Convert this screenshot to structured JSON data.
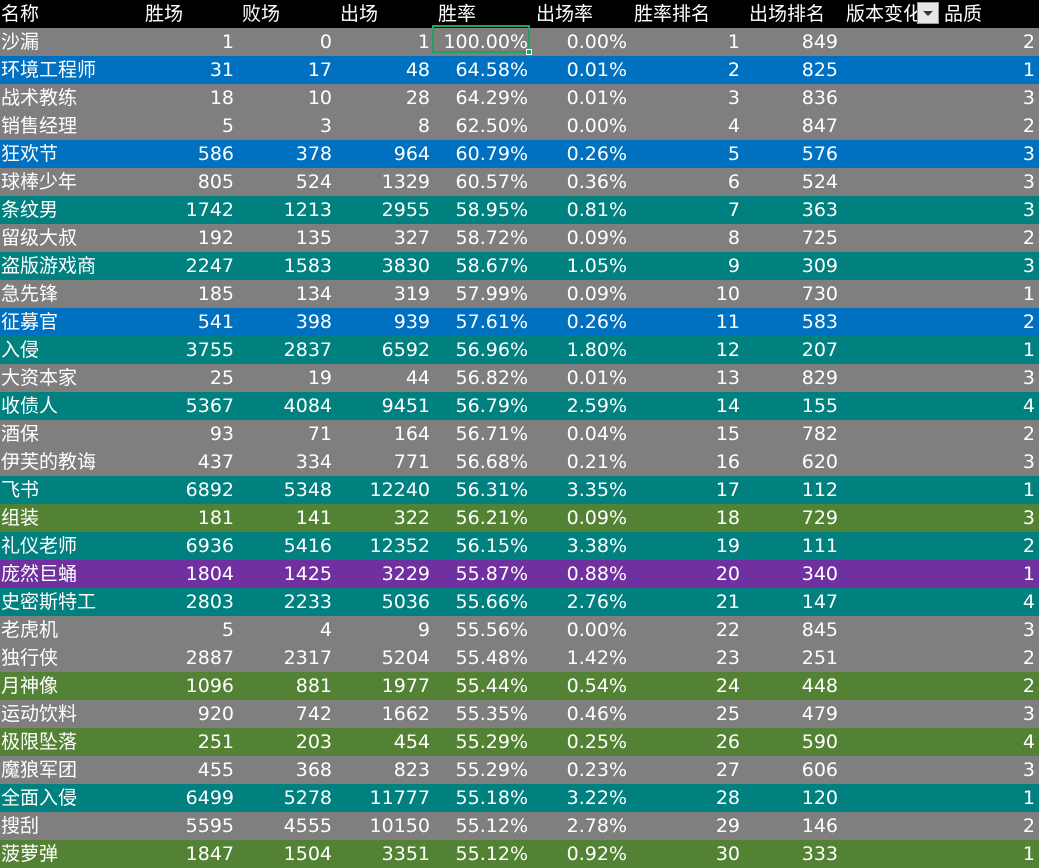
{
  "headers": [
    "名称",
    "胜场",
    "败场",
    "出场",
    "胜率",
    "出场率",
    "胜率排名",
    "出场排名",
    "版本变化",
    "品质"
  ],
  "colors": {
    "gray": "#7f7f7f",
    "blue": "#0070c0",
    "teal": "#00807f",
    "olive": "#548235",
    "purple": "#7030a0",
    "header": "#000000",
    "selection": "#21a366"
  },
  "filter_icon": "dropdown-arrow-icon",
  "rows": [
    {
      "name": "沙漏",
      "wins": "1",
      "losses": "0",
      "games": "1",
      "win_rate": "100.00%",
      "play_rate": "0.00%",
      "win_rank": "1",
      "play_rank": "849",
      "version_change": "",
      "quality": "2",
      "color": "gray"
    },
    {
      "name": "环境工程师",
      "wins": "31",
      "losses": "17",
      "games": "48",
      "win_rate": "64.58%",
      "play_rate": "0.01%",
      "win_rank": "2",
      "play_rank": "825",
      "version_change": "",
      "quality": "1",
      "color": "blue"
    },
    {
      "name": "战术教练",
      "wins": "18",
      "losses": "10",
      "games": "28",
      "win_rate": "64.29%",
      "play_rate": "0.01%",
      "win_rank": "3",
      "play_rank": "836",
      "version_change": "",
      "quality": "3",
      "color": "gray"
    },
    {
      "name": "销售经理",
      "wins": "5",
      "losses": "3",
      "games": "8",
      "win_rate": "62.50%",
      "play_rate": "0.00%",
      "win_rank": "4",
      "play_rank": "847",
      "version_change": "",
      "quality": "2",
      "color": "gray"
    },
    {
      "name": "狂欢节",
      "wins": "586",
      "losses": "378",
      "games": "964",
      "win_rate": "60.79%",
      "play_rate": "0.26%",
      "win_rank": "5",
      "play_rank": "576",
      "version_change": "",
      "quality": "3",
      "color": "blue"
    },
    {
      "name": "球棒少年",
      "wins": "805",
      "losses": "524",
      "games": "1329",
      "win_rate": "60.57%",
      "play_rate": "0.36%",
      "win_rank": "6",
      "play_rank": "524",
      "version_change": "",
      "quality": "3",
      "color": "gray"
    },
    {
      "name": "条纹男",
      "wins": "1742",
      "losses": "1213",
      "games": "2955",
      "win_rate": "58.95%",
      "play_rate": "0.81%",
      "win_rank": "7",
      "play_rank": "363",
      "version_change": "",
      "quality": "3",
      "color": "teal"
    },
    {
      "name": "留级大叔",
      "wins": "192",
      "losses": "135",
      "games": "327",
      "win_rate": "58.72%",
      "play_rate": "0.09%",
      "win_rank": "8",
      "play_rank": "725",
      "version_change": "",
      "quality": "2",
      "color": "gray"
    },
    {
      "name": "盗版游戏商",
      "wins": "2247",
      "losses": "1583",
      "games": "3830",
      "win_rate": "58.67%",
      "play_rate": "1.05%",
      "win_rank": "9",
      "play_rank": "309",
      "version_change": "",
      "quality": "3",
      "color": "teal"
    },
    {
      "name": "急先锋",
      "wins": "185",
      "losses": "134",
      "games": "319",
      "win_rate": "57.99%",
      "play_rate": "0.09%",
      "win_rank": "10",
      "play_rank": "730",
      "version_change": "",
      "quality": "1",
      "color": "gray"
    },
    {
      "name": "征募官",
      "wins": "541",
      "losses": "398",
      "games": "939",
      "win_rate": "57.61%",
      "play_rate": "0.26%",
      "win_rank": "11",
      "play_rank": "583",
      "version_change": "",
      "quality": "2",
      "color": "blue"
    },
    {
      "name": "入侵",
      "wins": "3755",
      "losses": "2837",
      "games": "6592",
      "win_rate": "56.96%",
      "play_rate": "1.80%",
      "win_rank": "12",
      "play_rank": "207",
      "version_change": "",
      "quality": "1",
      "color": "teal"
    },
    {
      "name": "大资本家",
      "wins": "25",
      "losses": "19",
      "games": "44",
      "win_rate": "56.82%",
      "play_rate": "0.01%",
      "win_rank": "13",
      "play_rank": "829",
      "version_change": "",
      "quality": "3",
      "color": "gray"
    },
    {
      "name": "收债人",
      "wins": "5367",
      "losses": "4084",
      "games": "9451",
      "win_rate": "56.79%",
      "play_rate": "2.59%",
      "win_rank": "14",
      "play_rank": "155",
      "version_change": "",
      "quality": "4",
      "color": "teal"
    },
    {
      "name": "酒保",
      "wins": "93",
      "losses": "71",
      "games": "164",
      "win_rate": "56.71%",
      "play_rate": "0.04%",
      "win_rank": "15",
      "play_rank": "782",
      "version_change": "",
      "quality": "2",
      "color": "gray"
    },
    {
      "name": "伊芙的教诲",
      "wins": "437",
      "losses": "334",
      "games": "771",
      "win_rate": "56.68%",
      "play_rate": "0.21%",
      "win_rank": "16",
      "play_rank": "620",
      "version_change": "",
      "quality": "3",
      "color": "gray"
    },
    {
      "name": "飞书",
      "wins": "6892",
      "losses": "5348",
      "games": "12240",
      "win_rate": "56.31%",
      "play_rate": "3.35%",
      "win_rank": "17",
      "play_rank": "112",
      "version_change": "",
      "quality": "1",
      "color": "teal"
    },
    {
      "name": "组装",
      "wins": "181",
      "losses": "141",
      "games": "322",
      "win_rate": "56.21%",
      "play_rate": "0.09%",
      "win_rank": "18",
      "play_rank": "729",
      "version_change": "",
      "quality": "3",
      "color": "olive"
    },
    {
      "name": "礼仪老师",
      "wins": "6936",
      "losses": "5416",
      "games": "12352",
      "win_rate": "56.15%",
      "play_rate": "3.38%",
      "win_rank": "19",
      "play_rank": "111",
      "version_change": "",
      "quality": "2",
      "color": "teal"
    },
    {
      "name": "庞然巨蛹",
      "wins": "1804",
      "losses": "1425",
      "games": "3229",
      "win_rate": "55.87%",
      "play_rate": "0.88%",
      "win_rank": "20",
      "play_rank": "340",
      "version_change": "",
      "quality": "1",
      "color": "purple"
    },
    {
      "name": "史密斯特工",
      "wins": "2803",
      "losses": "2233",
      "games": "5036",
      "win_rate": "55.66%",
      "play_rate": "2.76%",
      "win_rank": "21",
      "play_rank": "147",
      "version_change": "",
      "quality": "4",
      "color": "teal"
    },
    {
      "name": "老虎机",
      "wins": "5",
      "losses": "4",
      "games": "9",
      "win_rate": "55.56%",
      "play_rate": "0.00%",
      "win_rank": "22",
      "play_rank": "845",
      "version_change": "",
      "quality": "3",
      "color": "gray"
    },
    {
      "name": "独行侠",
      "wins": "2887",
      "losses": "2317",
      "games": "5204",
      "win_rate": "55.48%",
      "play_rate": "1.42%",
      "win_rank": "23",
      "play_rank": "251",
      "version_change": "",
      "quality": "2",
      "color": "gray"
    },
    {
      "name": "月神像",
      "wins": "1096",
      "losses": "881",
      "games": "1977",
      "win_rate": "55.44%",
      "play_rate": "0.54%",
      "win_rank": "24",
      "play_rank": "448",
      "version_change": "",
      "quality": "2",
      "color": "olive"
    },
    {
      "name": "运动饮料",
      "wins": "920",
      "losses": "742",
      "games": "1662",
      "win_rate": "55.35%",
      "play_rate": "0.46%",
      "win_rank": "25",
      "play_rank": "479",
      "version_change": "",
      "quality": "3",
      "color": "gray"
    },
    {
      "name": "极限坠落",
      "wins": "251",
      "losses": "203",
      "games": "454",
      "win_rate": "55.29%",
      "play_rate": "0.25%",
      "win_rank": "26",
      "play_rank": "590",
      "version_change": "",
      "quality": "4",
      "color": "olive"
    },
    {
      "name": "魔狼军团",
      "wins": "455",
      "losses": "368",
      "games": "823",
      "win_rate": "55.29%",
      "play_rate": "0.23%",
      "win_rank": "27",
      "play_rank": "606",
      "version_change": "",
      "quality": "3",
      "color": "gray"
    },
    {
      "name": "全面入侵",
      "wins": "6499",
      "losses": "5278",
      "games": "11777",
      "win_rate": "55.18%",
      "play_rate": "3.22%",
      "win_rank": "28",
      "play_rank": "120",
      "version_change": "",
      "quality": "1",
      "color": "teal"
    },
    {
      "name": "搜刮",
      "wins": "5595",
      "losses": "4555",
      "games": "10150",
      "win_rate": "55.12%",
      "play_rate": "2.78%",
      "win_rank": "29",
      "play_rank": "146",
      "version_change": "",
      "quality": "2",
      "color": "gray"
    },
    {
      "name": "菠萝弹",
      "wins": "1847",
      "losses": "1504",
      "games": "3351",
      "win_rate": "55.12%",
      "play_rate": "0.92%",
      "win_rank": "30",
      "play_rank": "333",
      "version_change": "",
      "quality": "1",
      "color": "olive"
    }
  ]
}
